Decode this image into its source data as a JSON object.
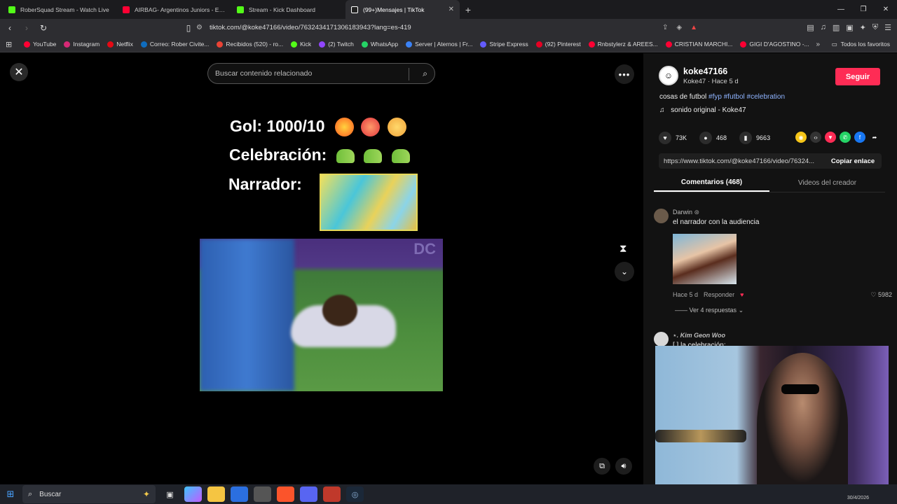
{
  "browser": {
    "tabs": [
      {
        "title": "RoberSquad Stream - Watch Live",
        "favicon_color": "#53fc18",
        "active": false
      },
      {
        "title": "AIRBAG- Argentinos Juniors - EN VIV",
        "favicon_color": "#ff0033",
        "active": false
      },
      {
        "title": "Stream - Kick Dashboard",
        "favicon_color": "#53fc18",
        "active": false
      },
      {
        "title": "(99+)Mensajes | TikTok",
        "favicon_color": "#ffffff",
        "active": true
      }
    ],
    "new_tab": "+",
    "url": "tiktok.com/@koke47166/video/7632434171306183943?lang=es-419",
    "bookmarks": [
      {
        "label": "YouTube",
        "color": "#ff0033"
      },
      {
        "label": "Instagram",
        "color": "#d62976"
      },
      {
        "label": "Netflix",
        "color": "#e50914"
      },
      {
        "label": "Correo: Rober Civite...",
        "color": "#0f6cbd"
      },
      {
        "label": "Recibidos (520) - ro...",
        "color": "#ea4335"
      },
      {
        "label": "Kick",
        "color": "#53fc18"
      },
      {
        "label": "(2) Twitch",
        "color": "#9146ff"
      },
      {
        "label": "WhatsApp",
        "color": "#25d366"
      },
      {
        "label": "Server | Aternos | Fr...",
        "color": "#3b82f6"
      },
      {
        "label": "Stripe Express",
        "color": "#635bff"
      },
      {
        "label": "(92) Pinterest",
        "color": "#e60023"
      },
      {
        "label": "Rnbstylerz & AREES...",
        "color": "#ff0033"
      },
      {
        "label": "CRISTIAN MARCHI...",
        "color": "#ff0033"
      },
      {
        "label": "GIGI D'AGOSTINO -...",
        "color": "#ff0033"
      }
    ],
    "all_bookmarks": "Todos los favoritos"
  },
  "video": {
    "search_placeholder": "Buscar contenido relacionado",
    "line1": "Gol: 1000/10",
    "line2": "Celebración:",
    "line3": "Narrador:",
    "clip_logo": "DC"
  },
  "panel": {
    "username": "koke47166",
    "subline": "Koke47 · Hace 5 d",
    "follow": "Seguir",
    "caption_text": "cosas de futbol",
    "hashtags": [
      "#fyp",
      "#futbol",
      "#celebration"
    ],
    "music": "sonido original - Koke47",
    "likes": "73K",
    "comments": "468",
    "saves": "9663",
    "link": "https://www.tiktok.com/@koke47166/video/76324...",
    "copy_link": "Copiar enlace",
    "tab_comments": "Comentarios (468)",
    "tab_creator": "Videos del creador",
    "comment1": {
      "name": "Darwin",
      "text": "el narrador con la audiencia",
      "time": "Hace 5 d",
      "reply": "Responder",
      "likes": "5982",
      "view_replies": "Ver 4 respuestas"
    },
    "comment2": {
      "name": "⋆. Kim Geon Woo",
      "text": "[ ] la celebración:"
    }
  },
  "taskbar": {
    "search": "Buscar",
    "date": "30/4/2026"
  }
}
